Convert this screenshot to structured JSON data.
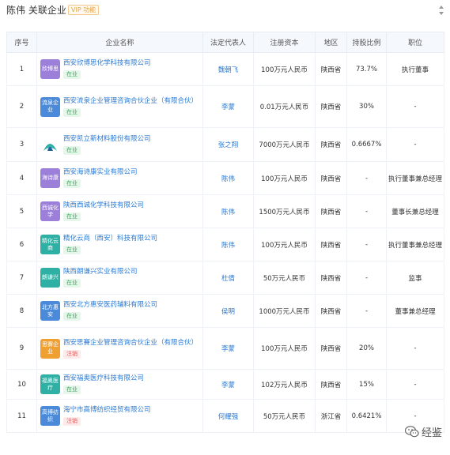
{
  "header": {
    "title": "陈伟 关联企业",
    "badge": "VIP 功能"
  },
  "colors": {
    "purple": "#9b7fd9",
    "teal": "#2fb0a4",
    "blue": "#4a8ad8",
    "orange": "#f0a030",
    "link": "#2a7ad4",
    "header_bg": "#f5f8fd"
  },
  "table": {
    "headers": [
      "序号",
      "企业名称",
      "法定代表人",
      "注册资本",
      "地区",
      "持股比例",
      "职位"
    ],
    "rows": [
      {
        "no": "1",
        "logo": "欣博思",
        "logo_color": "#9b7fd9",
        "name": "西安欣博思化学科技有限公司",
        "status": "在业",
        "rep": "魏朝飞",
        "capital": "100万元人民币",
        "region": "陕西省",
        "share": "73.7%",
        "position": "执行董事"
      },
      {
        "no": "2",
        "logo": "流泉企业",
        "logo_color": "#4a8ad8",
        "name": "西安流泉企业管理咨询合伙企业（有限合伙）",
        "status": "在业",
        "rep": "李蒙",
        "capital": "0.01万元人民币",
        "region": "陕西省",
        "share": "30%",
        "position": "-"
      },
      {
        "no": "3",
        "logo": "凯立",
        "logo_color": "#ffffff",
        "name": "西安凯立新材料股份有限公司",
        "status": "在业",
        "rep": "张之翔",
        "capital": "7000万元人民币",
        "region": "陕西省",
        "share": "0.6667%",
        "position": "-"
      },
      {
        "no": "4",
        "logo": "海诗康",
        "logo_color": "#9b7fd9",
        "name": "西安海诗康实业有限公司",
        "status": "在业",
        "rep": "陈伟",
        "capital": "100万元人民币",
        "region": "陕西省",
        "share": "-",
        "position": "执行董事兼总经理"
      },
      {
        "no": "5",
        "logo": "西诚化学",
        "logo_color": "#9b7fd9",
        "name": "陕西西诚化学科技有限公司",
        "status": "在业",
        "rep": "陈伟",
        "capital": "1500万元人民币",
        "region": "陕西省",
        "share": "-",
        "position": "董事长兼总经理"
      },
      {
        "no": "6",
        "logo": "精化云商",
        "logo_color": "#2fb0a4",
        "name": "精化云商（西安）科技有限公司",
        "status": "在业",
        "rep": "陈伟",
        "capital": "100万元人民币",
        "region": "陕西省",
        "share": "-",
        "position": "执行董事兼总经理"
      },
      {
        "no": "7",
        "logo": "朗谦兴",
        "logo_color": "#2fb0a4",
        "name": "陕西朗谦兴实业有限公司",
        "status": "在业",
        "rep": "杜倩",
        "capital": "50万元人民币",
        "region": "陕西省",
        "share": "-",
        "position": "监事"
      },
      {
        "no": "8",
        "logo": "北方惠安",
        "logo_color": "#4a8ad8",
        "name": "西安北方惠安医药辅料有限公司",
        "status": "在业",
        "rep": "侯明",
        "capital": "1000万元人民币",
        "region": "陕西省",
        "share": "-",
        "position": "董事兼总经理"
      },
      {
        "no": "9",
        "logo": "思賽企业",
        "logo_color": "#f0a030",
        "name": "西安思賽企业管理咨询合伙企业（有限合伙）",
        "status": "注销",
        "rep": "李蒙",
        "capital": "100万元人民币",
        "region": "陕西省",
        "share": "20%",
        "position": "-"
      },
      {
        "no": "10",
        "logo": "福奥医疗",
        "logo_color": "#2fb0a4",
        "name": "西安福奥医疗科技有限公司",
        "status": "在业",
        "rep": "李蒙",
        "capital": "102万元人民币",
        "region": "陕西省",
        "share": "15%",
        "position": "-"
      },
      {
        "no": "11",
        "logo": "高博纺织",
        "logo_color": "#4a8ad8",
        "name": "海宁市高博纺织经贸有限公司",
        "status": "注销",
        "rep": "何耀强",
        "capital": "50万元人民币",
        "region": "浙江省",
        "share": "0.6421%",
        "position": "-"
      }
    ]
  },
  "watermark": {
    "text": "经鉴",
    "icon": "wechat-icon"
  }
}
